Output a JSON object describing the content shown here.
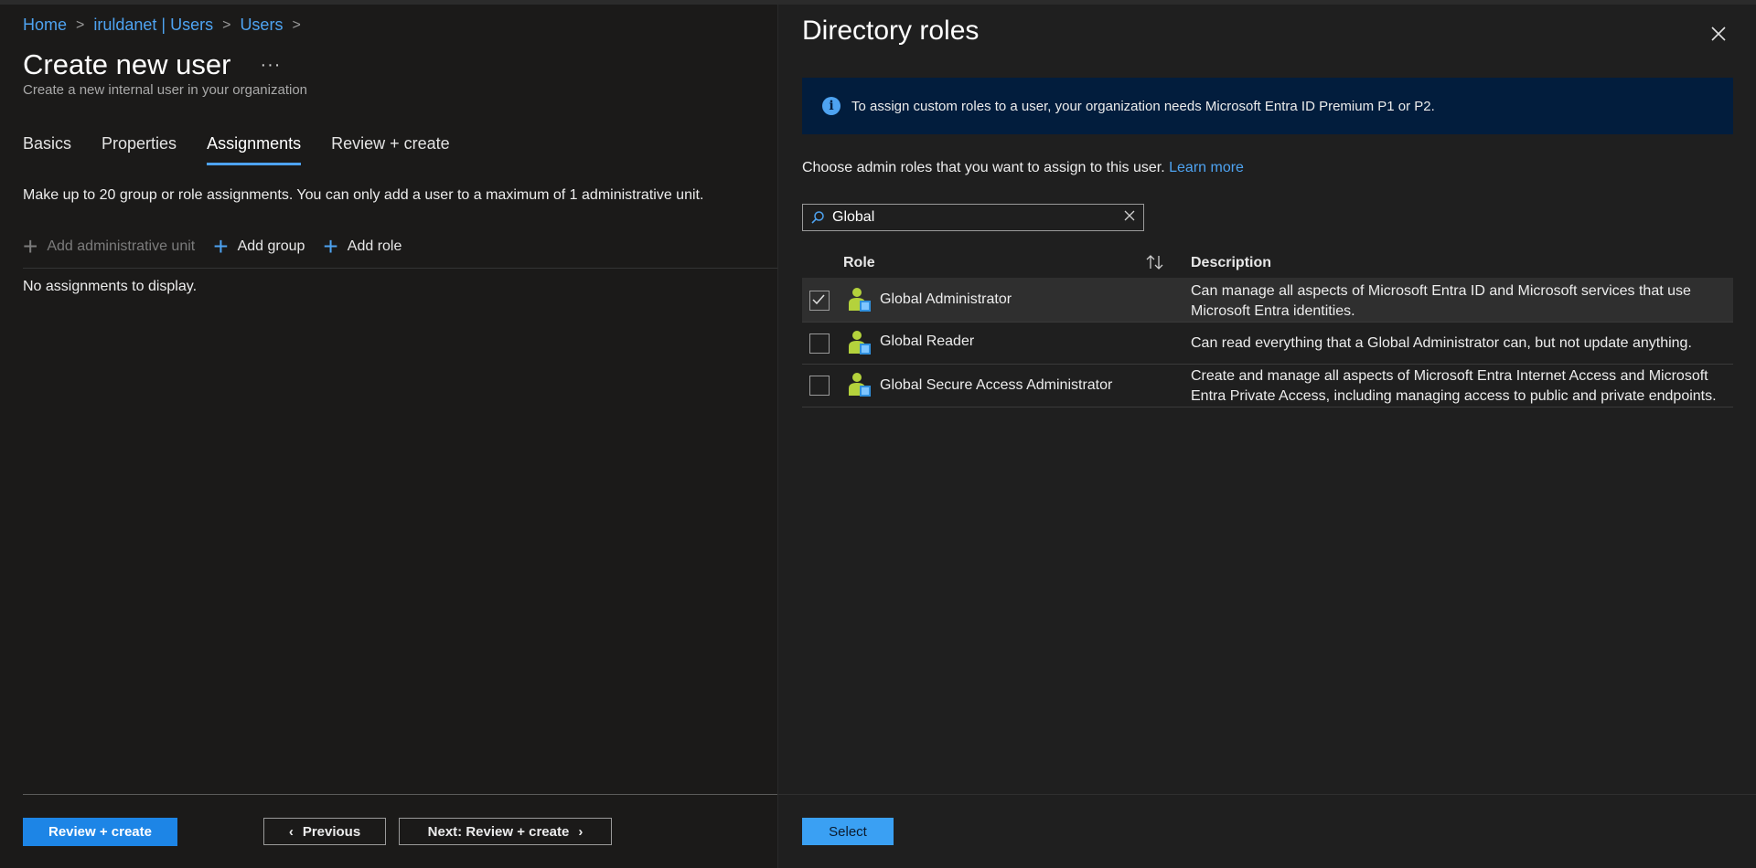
{
  "breadcrumb": [
    {
      "label": "Home"
    },
    {
      "label": "iruldanet | Users"
    },
    {
      "label": "Users"
    }
  ],
  "page": {
    "title": "Create new user",
    "more_label": "···",
    "subtitle": "Create a new internal user in your organization"
  },
  "tabs": [
    {
      "label": "Basics",
      "active": false
    },
    {
      "label": "Properties",
      "active": false
    },
    {
      "label": "Assignments",
      "active": true
    },
    {
      "label": "Review + create",
      "active": false
    }
  ],
  "assignments": {
    "info": "Make up to 20 group or role assignments. You can only add a user to a maximum of 1 administrative unit.",
    "add_admin_unit": "Add administrative unit",
    "add_group": "Add group",
    "add_role": "Add role",
    "empty": "No assignments to display."
  },
  "footer": {
    "review_create": "Review + create",
    "previous": "Previous",
    "next": "Next: Review + create"
  },
  "panel": {
    "title": "Directory roles",
    "banner": "To assign custom roles to a user, your organization needs Microsoft Entra ID Premium P1 or P2.",
    "choose_text": "Choose admin roles that you want to assign to this user.",
    "learn_more": "Learn more",
    "search_value": "Global",
    "col_role": "Role",
    "col_description": "Description",
    "select_label": "Select",
    "roles": [
      {
        "name": "Global Administrator",
        "checked": true,
        "description": "Can manage all aspects of Microsoft Entra ID and Microsoft services that use Microsoft Entra identities."
      },
      {
        "name": "Global Reader",
        "checked": false,
        "description": "Can read everything that a Global Administrator can, but not update anything."
      },
      {
        "name": "Global Secure Access Administrator",
        "checked": false,
        "description": "Create and manage all aspects of Microsoft Entra Internet Access and Microsoft Entra Private Access, including managing access to public and private endpoints."
      }
    ]
  },
  "colors": {
    "accent": "#4ea3f1",
    "primary_button": "#1d85e6",
    "banner_bg": "#021d3d"
  }
}
